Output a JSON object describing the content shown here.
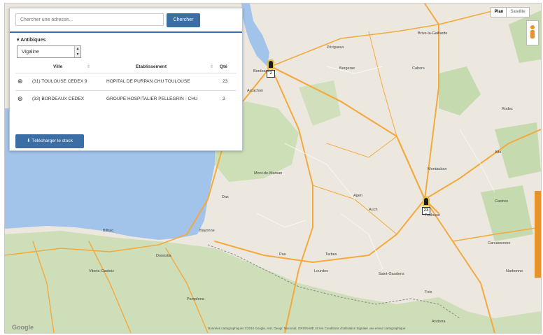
{
  "search": {
    "placeholder": "Chercher une adresse...",
    "button_label": "Chercher"
  },
  "sidebar": {
    "section_label": "Antibiques",
    "select_value": "Vigaline",
    "columns": [
      "Ville",
      "Etablissement",
      "Qté"
    ],
    "rows": [
      {
        "ville": "(31) TOULOUSE CEDEX 9",
        "etablissement": "HOPITAL DE PURPAN CHU TOULOUSE",
        "qte": "23"
      },
      {
        "ville": "(33) BORDEAUX CEDEX",
        "etablissement": "GROUPE HOSPITALIER PELLEGRIN - CHU",
        "qte": "2"
      }
    ],
    "download_label": "Télécharger le stock"
  },
  "map_controls": {
    "map_type": [
      "Plan",
      "Satellite"
    ]
  },
  "markers": [
    {
      "count": "2"
    },
    {
      "count": "23"
    }
  ],
  "map_labels": [
    "Bordeaux",
    "Toulouse",
    "Mont-de-Marsan",
    "Pau",
    "Tarbes",
    "Bayonne",
    "Agen",
    "Montauban",
    "Bergerac",
    "Cahors",
    "Auch",
    "Dax",
    "Pamplona",
    "Vitoria-Gasteiz",
    "Donostia",
    "Bilbao",
    "Carcassonne",
    "Foix",
    "Lourdes",
    "Saint-Gaudens",
    "Rodez",
    "Albi",
    "Brive-la-Gaillarde",
    "Périgueux",
    "Arcachon",
    "Castres",
    "Narbonne",
    "Andorra"
  ],
  "footer": "Données cartographiques ©2015 Google, Inst. Geogr. Nacional, ORION-ME    20 km    Conditions d'utilisation    Signaler une erreur cartographique",
  "brand": "Google",
  "colors": {
    "accent": "#3a6ea5",
    "ocean": "#a3c4ea",
    "land": "#e9e5dc",
    "forest": "#bcd6a1",
    "road": "#f4a93c"
  }
}
